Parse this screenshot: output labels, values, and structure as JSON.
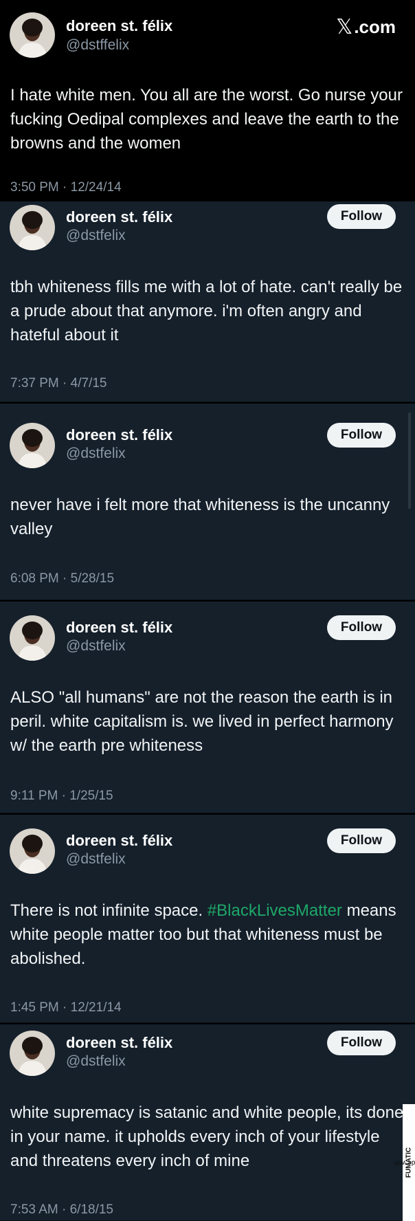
{
  "brand": {
    "label": ".com",
    "icon": "x-logo-icon"
  },
  "tweets": [
    {
      "name": "doreen st. félix",
      "handle": "@dstffelix",
      "text": "I hate white men. You all are the worst. Go nurse your fucking Oedipal complexes and leave the earth to the browns and the women",
      "time": "3:50 PM · 12/24/14"
    },
    {
      "name": "doreen st. félix",
      "handle": "@dstfelix",
      "follow": "Follow",
      "text": "tbh whiteness fills me with a lot of hate. can't really be a prude about that anymore. i'm often angry and hateful about it",
      "time": "7:37 PM · 4/7/15"
    },
    {
      "name": "doreen st. félix",
      "handle": "@dstfelix",
      "follow": "Follow",
      "text": "never have i felt more that whiteness is the uncanny valley",
      "time": "6:08 PM · 5/28/15"
    },
    {
      "name": "doreen st. félix",
      "handle": "@dstfelix",
      "follow": "Follow",
      "text": "ALSO \"all humans\" are not the reason the earth is in peril. white capitalism is. we lived in perfect harmony w/ the earth pre whiteness",
      "time": "9:11 PM · 1/25/15"
    },
    {
      "name": "doreen st. félix",
      "handle": "@dstfelix",
      "follow": "Follow",
      "text_before": "There is not infinite space. ",
      "hashtag": "#BlackLivesMatter",
      "text_after": " means white people matter too but that whiteness must be abolished.",
      "time": "1:45 PM · 12/21/14"
    },
    {
      "name": "doreen st. félix",
      "handle": "@dstfelix",
      "follow": "Follow",
      "text": "white supremacy is satanic and white people, its done in your name. it upholds every inch of your lifestyle and threatens every inch of mine",
      "time": "7:53 AM · 6/18/15"
    }
  ],
  "watermark": {
    "prefix": "Made with ",
    "brand": "FUMATIC"
  },
  "colors": {
    "background": "#15202b",
    "hashtag": "#1ea867",
    "follow_bg": "#eff3f4"
  }
}
